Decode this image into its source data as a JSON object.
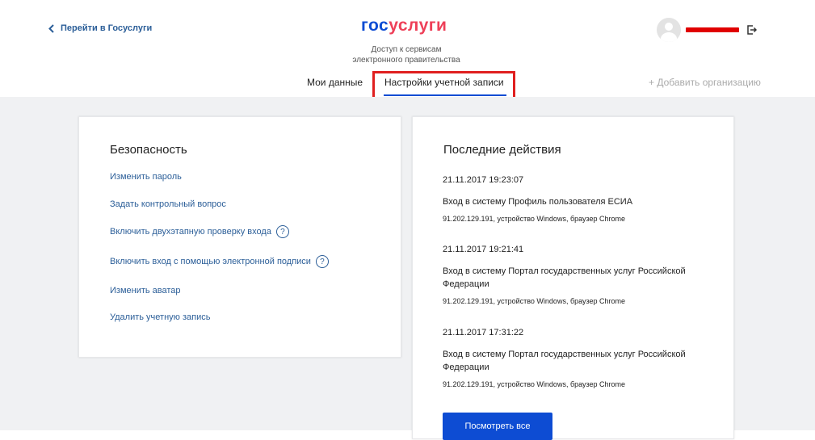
{
  "header": {
    "back_link": "Перейти в Госуслуги",
    "logo": {
      "part1": "гос",
      "part2": "услуги"
    },
    "tagline": [
      "Доступ к сервисам",
      "электронного правительства"
    ],
    "user": {
      "name": "",
      "avatar_icon": "user-avatar",
      "logout_icon": "logout-icon"
    }
  },
  "tabs": [
    {
      "label": "Мои данные",
      "active": false
    },
    {
      "label": "Настройки учетной записи",
      "active": true
    }
  ],
  "add_org": "+ Добавить организацию",
  "security": {
    "title": "Безопасность",
    "links": [
      {
        "label": "Изменить пароль",
        "help": false
      },
      {
        "label": "Задать контрольный вопрос",
        "help": false
      },
      {
        "label": "Включить двухэтапную проверку входа",
        "help": true
      },
      {
        "label": "Включить вход с помощью электронной подписи",
        "help": true
      },
      {
        "label": "Изменить аватар",
        "help": false
      },
      {
        "label": "Удалить учетную запись",
        "help": false
      }
    ],
    "help_glyph": "?"
  },
  "recent": {
    "title": "Последние действия",
    "items": [
      {
        "time": "21.11.2017 19:23:07",
        "title": "Вход в систему Профиль пользователя ЕСИА",
        "details": "91.202.129.191, устройство Windows, браузер Chrome"
      },
      {
        "time": "21.11.2017 19:21:41",
        "title": "Вход в систему Портал государственных услуг Российской Федерации",
        "details": "91.202.129.191, устройство Windows, браузер Chrome"
      },
      {
        "time": "21.11.2017 17:31:22",
        "title": "Вход в систему Портал государственных услуг Российской Федерации",
        "details": "91.202.129.191, устройство Windows, браузер Chrome"
      }
    ],
    "view_all": "Посмотреть все"
  },
  "colors": {
    "brand_blue": "#0d4cd3",
    "brand_red": "#ee3f58",
    "link": "#2b5e98",
    "highlight": "#e01f1f"
  }
}
